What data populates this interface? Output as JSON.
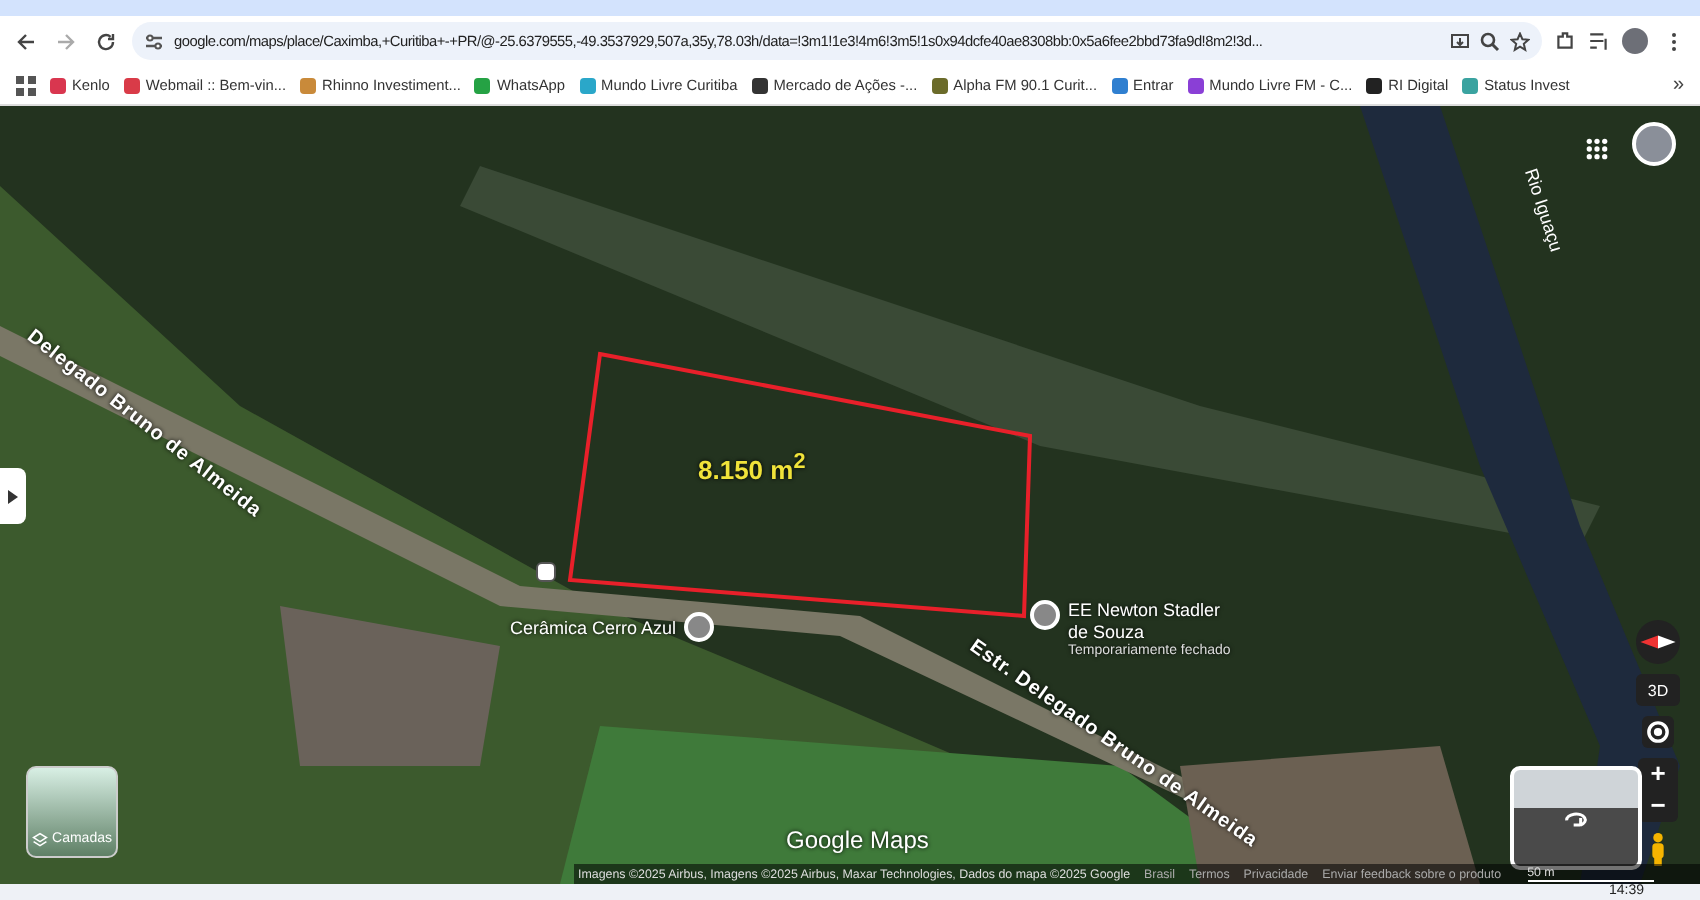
{
  "browser": {
    "url": "google.com/maps/place/Caximba,+Curitiba+-+PR/@-25.6379555,-49.3537929,507a,35y,78.03h/data=!3m1!1e3!4m6!3m5!1s0x94dcfe40ae8308bb:0x5a6fee2bbd73fa9d!8m2!3d...",
    "bookmarks": [
      {
        "label": "Kenlo",
        "color": "#d9364f"
      },
      {
        "label": "Webmail :: Bem-vin...",
        "color": "#d93b48"
      },
      {
        "label": "Rhinno Investiment...",
        "color": "#c98a3a"
      },
      {
        "label": "WhatsApp",
        "color": "#25a244"
      },
      {
        "label": "Mundo Livre Curitiba",
        "color": "#2aa7c9"
      },
      {
        "label": "Mercado de Ações -...",
        "color": "#333333"
      },
      {
        "label": "Alpha FM 90.1 Curit...",
        "color": "#6b6b2a"
      },
      {
        "label": "Entrar",
        "color": "#2f7fd0"
      },
      {
        "label": "Mundo Livre FM - C...",
        "color": "#8a3fd6"
      },
      {
        "label": "RI Digital",
        "color": "#222222"
      },
      {
        "label": "Status Invest",
        "color": "#3aa3a0"
      }
    ],
    "bookmarks_more": "»"
  },
  "map": {
    "area_label": "8.150 m$^{2}$",
    "road_labels": [
      "Delegado Bruno de Almeida",
      "Estr. Delegado Bruno de Almeida"
    ],
    "river_label": "Rio Iguaçu",
    "places": [
      {
        "name": "Cerâmica Cerro Azul"
      },
      {
        "name": "EE Newton Stadler de Souza",
        "status": "Temporariamente fechado"
      }
    ],
    "layers_label": "Camadas",
    "view_3d": "3D",
    "zoom_in": "+",
    "zoom_out": "−",
    "logo": "Google Maps",
    "attribution": "Imagens ©2025 Airbus, Imagens ©2025 Airbus, Maxar Technologies, Dados do mapa ©2025 Google",
    "footer_links": [
      "Brasil",
      "Termos",
      "Privacidade",
      "Enviar feedback sobre o produto"
    ],
    "scale": "50 m"
  },
  "taskbar": {
    "time": "14:39"
  }
}
